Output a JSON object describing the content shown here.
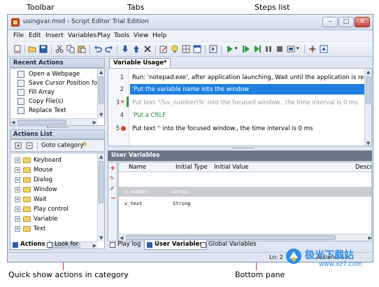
{
  "annotations": {
    "toolbar": "Toolbar",
    "tabs": "Tabs",
    "steps_list": "Steps list",
    "quick_show": "Quick show actions in category",
    "bottom_pane": "Bottom pane"
  },
  "window": {
    "title": "usingvar.msd - Script Editor  Trial Edition",
    "minimize": "–",
    "maximize": "□",
    "close": "✕"
  },
  "menu": [
    "File",
    "Edit",
    "Insert",
    "Variables",
    "Play",
    "Tools",
    "View",
    "Help"
  ],
  "recent_actions": {
    "header": "Recent Actions",
    "items": [
      "Open a Webpage",
      "Save Cursor Position for R",
      "Fill Array",
      "Copy File(s)",
      "Replace Text"
    ]
  },
  "actions_list": {
    "header": "Actions List",
    "goto_category": "Goto category",
    "categories": [
      "Keyboard",
      "Mouse",
      "Dialog",
      "Window",
      "Wait",
      "Play control",
      "Variable",
      "Text"
    ]
  },
  "left_tabs": [
    "Actions",
    "Look for"
  ],
  "editor": {
    "tab": "Variable Usage*",
    "steps": [
      {
        "num": "1",
        "text": "Run: 'notepad.exe', after application launching, Wait until the application is ready for input."
      },
      {
        "num": "2",
        "text": "'Put the variable name into the window"
      },
      {
        "num": "3",
        "text": "Put text '\\%v_number\\%' into the focused window., the time interval is 0 ms"
      },
      {
        "num": "4",
        "text": "'Put a CRLF"
      },
      {
        "num": "5",
        "text": "Put text '' into the focused window., the time interval is 0 ms"
      }
    ]
  },
  "user_variables": {
    "header": "User Variables",
    "columns": [
      "Name",
      "Initial Type",
      "Initial Value",
      "Descripti"
    ],
    "rows": [
      {
        "name": "v_number",
        "type": "Array",
        "value": ""
      },
      {
        "name": "v_text",
        "type": "String",
        "value": ""
      }
    ]
  },
  "bottom_tabs": [
    "Play log",
    "User Variables",
    "Global Variables"
  ],
  "status": {
    "ln": "Ln: 2",
    "actions": "Actions: 13"
  },
  "watermark": "极光下载站",
  "watermark_url": "www.xz7.com",
  "colors": {
    "annotation": "#e0242c",
    "selection": "#1e7fe0",
    "comment_green": "#208a34"
  }
}
